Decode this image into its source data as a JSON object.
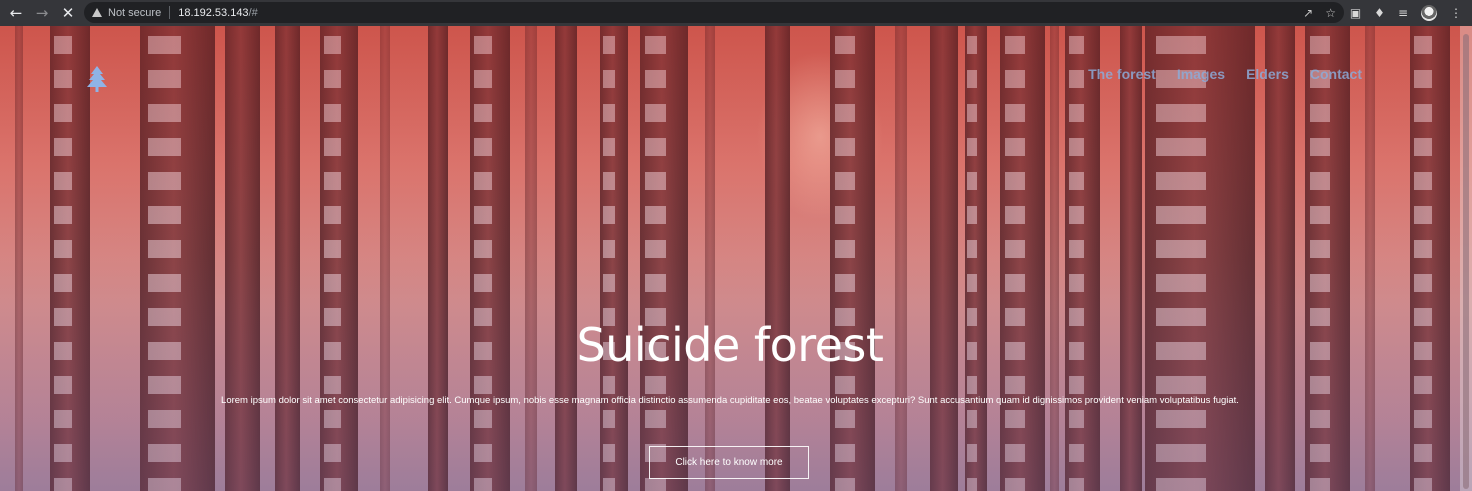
{
  "browser": {
    "security_label": "Not secure",
    "url_host": "18.192.53.143",
    "url_rest": "/#",
    "icons": {
      "back": "arrow-left-icon",
      "forward": "arrow-right-icon",
      "stop": "close-icon",
      "warning": "warning-icon",
      "share": "share-icon",
      "bookmark": "star-icon",
      "cast": "cast-icon",
      "extensions": "puzzle-icon",
      "reading_list": "reading-list-icon",
      "profile": "avatar-icon",
      "menu": "kebab-menu-icon"
    }
  },
  "site": {
    "logo_icon": "tree-icon",
    "nav": [
      {
        "label": "The forest"
      },
      {
        "label": "Images"
      },
      {
        "label": "Elders"
      },
      {
        "label": "Contact"
      }
    ],
    "hero": {
      "title": "Suicide forest",
      "text": "Lorem ipsum dolor sit amet consectetur adipisicing elit. Cumque ipsum, nobis esse magnam officia distinctio assumenda cupiditate eos, beatae voluptates excepturi? Sunt accusantium quam id dignissimos provident veniam voluptatibus fugiat.",
      "button_label": "Click here to know more"
    },
    "colors": {
      "overlay_top": "#c9544b",
      "overlay_bottom": "#a07f98",
      "nav_link": "#8caad7"
    }
  }
}
